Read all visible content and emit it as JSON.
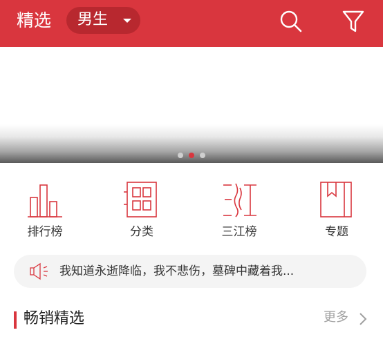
{
  "header": {
    "title": "精选",
    "gender_selector": "男生",
    "icons": [
      "search-icon",
      "filter-icon"
    ],
    "accent_color": "#d9363e"
  },
  "banner": {
    "carousel_dots": 3,
    "active_dot": 2
  },
  "quick_entries": [
    {
      "label": "排行榜",
      "icon": "ranking-bar-chart-icon"
    },
    {
      "label": "分类",
      "icon": "category-grid-icon"
    },
    {
      "label": "三江榜",
      "icon": "sanjiang-icon"
    },
    {
      "label": "专题",
      "icon": "topic-bookmark-icon"
    }
  ],
  "notice": {
    "icon": "speaker-icon",
    "text": "我知道永逝降临，我不悲伤，墓碑中藏着我..."
  },
  "section": {
    "title": "畅销精选",
    "more_label": "更多"
  }
}
